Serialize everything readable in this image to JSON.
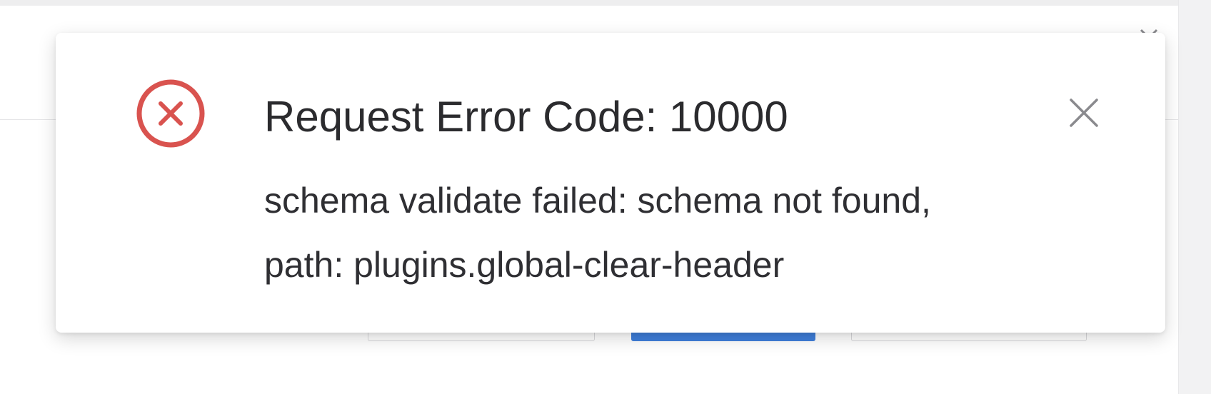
{
  "notification": {
    "type": "error",
    "title": "Request Error Code: 10000",
    "description_lines": [
      "schema validate failed: schema not found,",
      "path: plugins.global-clear-header"
    ],
    "icon": "error-circle-x-icon",
    "close_icon": "close-icon"
  },
  "colors": {
    "error": "#d9534f",
    "primary_button": "#3f7fdc",
    "text": "#2b2b2e",
    "close_icon": "#8a8a8e"
  },
  "background": {
    "drawer_close_icon": "close-icon"
  }
}
